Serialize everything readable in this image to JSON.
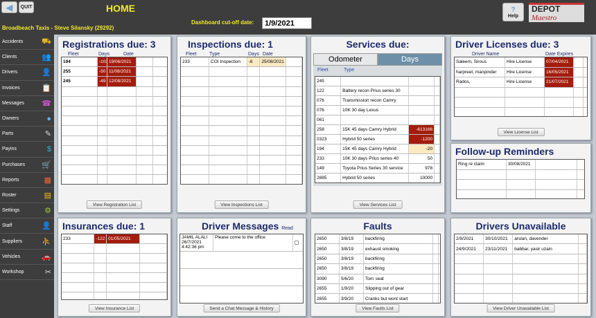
{
  "header": {
    "back_icon": "arrow-left-icon",
    "quit": "QUIT",
    "title": "HOME",
    "company": "Broadbeach Taxis - Steve Silansky (29292)",
    "cutoff_label": "Dashboard cut-off date:",
    "cutoff_value": "1/9/2021",
    "help": "Help",
    "logo_top": "DEPOT",
    "logo_bottom": "Maestro"
  },
  "sidebar": [
    {
      "label": "Accidents",
      "icon": "⛟",
      "color": "#e8b820"
    },
    {
      "label": "Clients",
      "icon": "👥",
      "color": "#5aa0d8"
    },
    {
      "label": "Drivers",
      "icon": "👤",
      "color": "#ddd"
    },
    {
      "label": "Invoices",
      "icon": "📋",
      "color": "#3cc"
    },
    {
      "label": "Messages",
      "icon": "☎",
      "color": "#c5c"
    },
    {
      "label": "Owners",
      "icon": "●",
      "color": "#6ad"
    },
    {
      "label": "Parts",
      "icon": "✎",
      "color": "#ddd"
    },
    {
      "label": "Payins",
      "icon": "$",
      "color": "#3ad"
    },
    {
      "label": "Purchases",
      "icon": "🛒",
      "color": "#8c3"
    },
    {
      "label": "Reports",
      "icon": "▦",
      "color": "#e63"
    },
    {
      "label": "Roster",
      "icon": "▤",
      "color": "#eb2"
    },
    {
      "label": "Settings",
      "icon": "⚙",
      "color": "#9c3"
    },
    {
      "label": "Staff",
      "icon": "👤",
      "color": "#fff"
    },
    {
      "label": "Suppliers",
      "icon": "⛹",
      "color": "#49d"
    },
    {
      "label": "Vehicles",
      "icon": "🚗",
      "color": "#e45"
    },
    {
      "label": "Workshop",
      "icon": "✂",
      "color": "#ddd"
    }
  ],
  "registrations": {
    "title": "Registrations due:",
    "count": "3",
    "cols": [
      "Fleet",
      "Days",
      "Date"
    ],
    "rows": [
      [
        "194",
        "-103",
        "19/06/2021"
      ],
      [
        "255",
        "-50",
        "11/08/2021"
      ],
      [
        "245",
        "-49",
        "12/08/2021"
      ]
    ],
    "button": "View Registration List"
  },
  "inspections": {
    "title": "Inspections due:",
    "count": "1",
    "cols": [
      "Fleet",
      "Type",
      "Days",
      "Date"
    ],
    "rows": [
      [
        "233",
        "COI Inspection",
        "-6",
        "25/08/2021"
      ]
    ],
    "button": "View Inspections List"
  },
  "services": {
    "title": "Services due:",
    "tabs": [
      "Odometer",
      "Days"
    ],
    "active_tab": "Days",
    "cols": [
      "Fleet",
      "Type"
    ],
    "rows": [
      [
        "245",
        "",
        ""
      ],
      [
        "122",
        "Battery recon Prius series 30",
        ""
      ],
      [
        "076",
        "Transmission recon Camry",
        ""
      ],
      [
        "076",
        "10K 30 day Lexus",
        ""
      ],
      [
        "061",
        "",
        ""
      ],
      [
        "258",
        "15K 45 days Camry Hybrid",
        "-613166"
      ],
      [
        "0323",
        "Hybrid 50 series",
        "-1200"
      ],
      [
        "194",
        "15K 45 days Camry Hybrid",
        "-20"
      ],
      [
        "233",
        "10K 30 days Prius series 40",
        "50"
      ],
      [
        "149",
        "Toyota Prius Series 30 service",
        "978"
      ],
      [
        "2885",
        "Hybrid 50 series",
        "10000"
      ]
    ],
    "button": "View Services List"
  },
  "licenses": {
    "title": "Driver Licenses due:",
    "count": "3",
    "cols": [
      "Driver Name",
      "Date Expires"
    ],
    "rows": [
      [
        "Saleem, Sirous",
        "Hire License",
        "07/04/2021"
      ],
      [
        "harpreet, manpinder",
        "Hire License",
        "16/05/2021"
      ],
      [
        "Rados,",
        "Hire License",
        "21/07/2021"
      ]
    ],
    "button": "View License List"
  },
  "reminders": {
    "title": "Follow-up Reminders",
    "rows": [
      [
        "Ring re claim",
        "30/08/2021"
      ]
    ]
  },
  "insurances": {
    "title": "Insurances due:",
    "count": "1",
    "rows": [
      [
        "233",
        "-122",
        "01/05/2021"
      ]
    ],
    "button": "View Insurance List"
  },
  "messages": {
    "title": "Driver Messages",
    "read_label": "Read",
    "rows": [
      {
        "sender": "JAMIL ALALI",
        "date": "26/7/2021",
        "time": "4:42:36 pm",
        "text": "Please come to the office",
        "read": false
      }
    ],
    "button": "Send a Chat Message & History"
  },
  "faults": {
    "title": "Faults",
    "rows": [
      [
        "2650",
        "3/8/19",
        "backfiring"
      ],
      [
        "2650",
        "3/8/19",
        "exhaust smoking"
      ],
      [
        "2650",
        "3/8/19",
        "backfiring"
      ],
      [
        "2650",
        "3/8/19",
        "backfiring"
      ],
      [
        "3090",
        "5/6/20",
        "Torn seat"
      ],
      [
        "2655",
        "1/9/20",
        "Slipping out of gear"
      ],
      [
        "2655",
        "3/9/20",
        "Cranks but wont start"
      ]
    ],
    "button": "View Faults List"
  },
  "unavailable": {
    "title": "Drivers Unavailable",
    "rows": [
      [
        "2/9/2021",
        "30/10/2021",
        "arslan, davender"
      ],
      [
        "24/9/2021",
        "23/11/2021",
        "babbar, yasir uzain"
      ]
    ],
    "button": "View Driver Unavailable List"
  }
}
